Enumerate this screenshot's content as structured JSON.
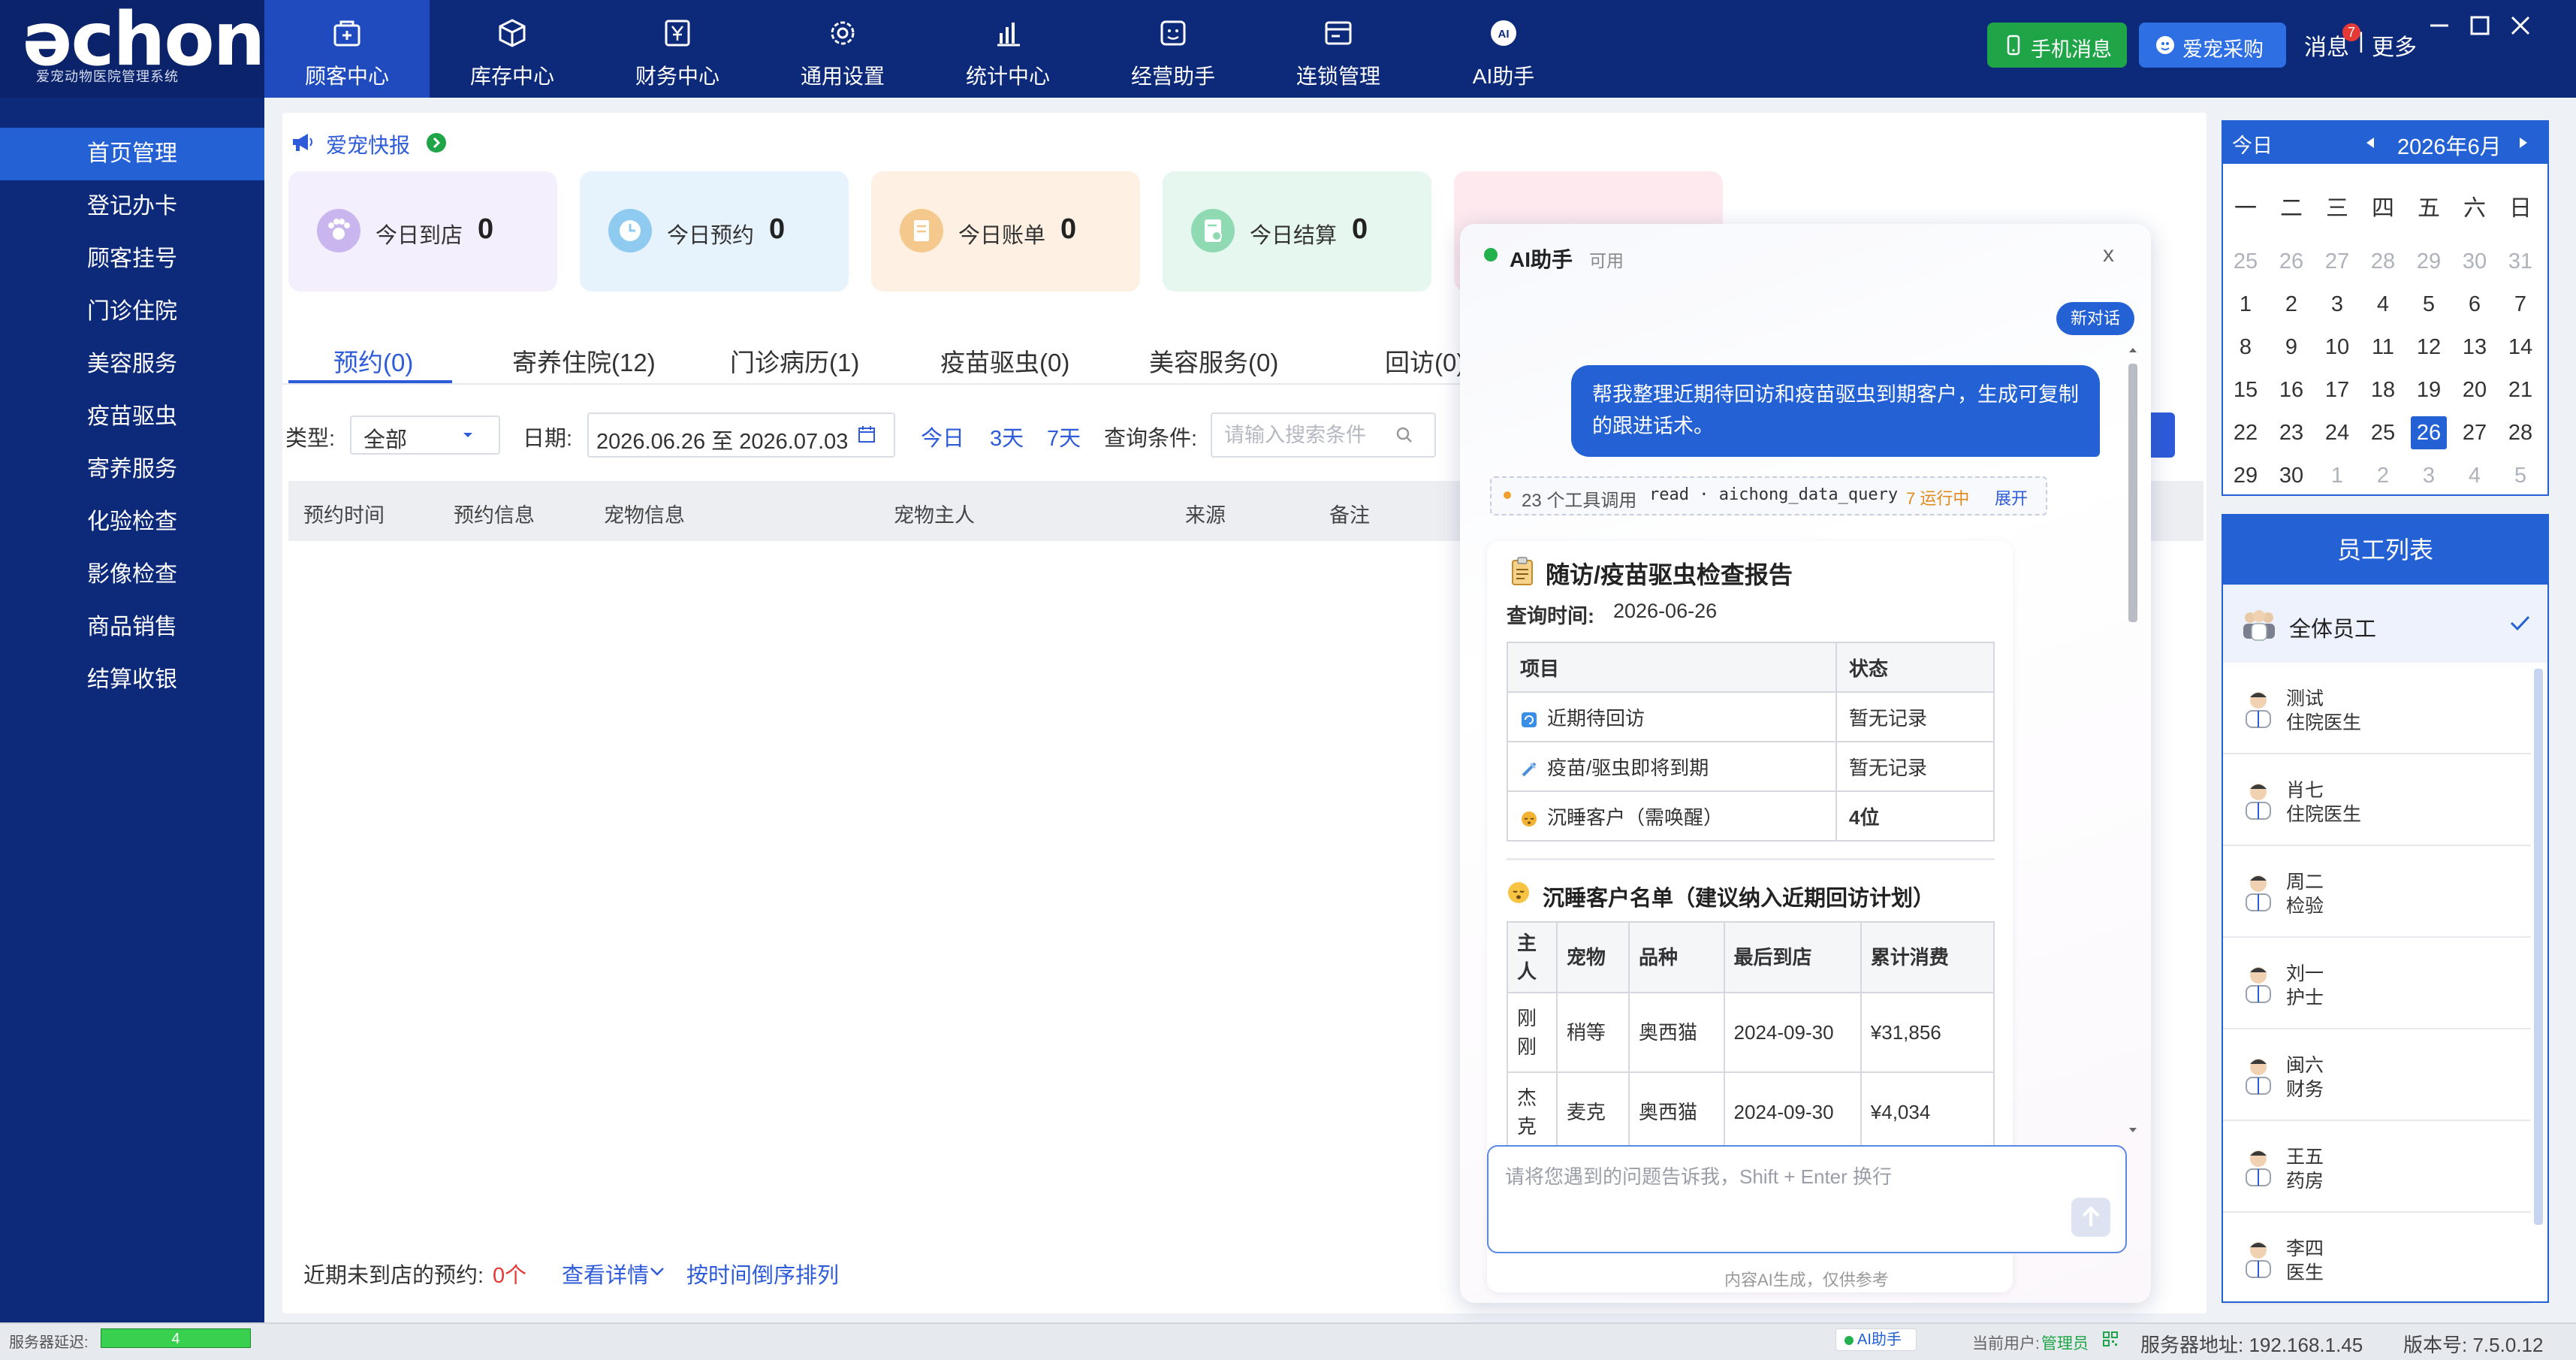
{
  "app": {
    "logo": "əchong",
    "logo_subtitle": "爱宠动物医院管理系统"
  },
  "topnav": [
    {
      "label": "顾客中心",
      "icon": "customer-center-icon",
      "active": true
    },
    {
      "label": "库存中心",
      "icon": "inventory-box-icon"
    },
    {
      "label": "财务中心",
      "icon": "finance-yen-icon"
    },
    {
      "label": "通用设置",
      "icon": "settings-gear-icon"
    },
    {
      "label": "统计中心",
      "icon": "statistics-chart-icon"
    },
    {
      "label": "经营助手",
      "icon": "business-assistant-icon"
    },
    {
      "label": "连锁管理",
      "icon": "chain-management-icon"
    },
    {
      "label": "AI助手",
      "icon": "ai-assistant-icon"
    }
  ],
  "window": {
    "mobile_msg": "手机消息",
    "purchase": "爱宠采购",
    "messages": "消息",
    "badge": "7",
    "separator": "|",
    "more": "更多"
  },
  "sidebar": [
    {
      "label": "首页管理",
      "active": true
    },
    {
      "label": "登记办卡"
    },
    {
      "label": "顾客挂号"
    },
    {
      "label": "门诊住院"
    },
    {
      "label": "美容服务"
    },
    {
      "label": "疫苗驱虫"
    },
    {
      "label": "寄养服务"
    },
    {
      "label": "化验检查"
    },
    {
      "label": "影像检查"
    },
    {
      "label": "商品销售"
    },
    {
      "label": "结算收银"
    }
  ],
  "bulletin": "爱宠快报",
  "cards": [
    {
      "label": "今日到店",
      "value": "0",
      "bg": "#f3effd",
      "icon_bg": "#c9b6ee",
      "icon": "paw-icon"
    },
    {
      "label": "今日预约",
      "value": "0",
      "bg": "#e6f3fd",
      "icon_bg": "#8fcaf1",
      "icon": "clock-icon"
    },
    {
      "label": "今日账单",
      "value": "0",
      "bg": "#fef1e3",
      "icon_bg": "#f5c88d",
      "icon": "bill-icon"
    },
    {
      "label": "今日结算",
      "value": "0",
      "bg": "#e6f7ef",
      "icon_bg": "#8fd9b3",
      "icon": "settlement-icon"
    }
  ],
  "tabs": [
    "预约(0)",
    "寄养住院(12)",
    "门诊病历(1)",
    "疫苗驱虫(0)",
    "美容服务(0)",
    "回访(0)"
  ],
  "filters": {
    "type_label": "类型:",
    "type_value": "全部",
    "date_label": "日期:",
    "date_range": "2026.06.26 至 2026.07.03",
    "quick": [
      "今日",
      "3天",
      "7天"
    ],
    "query_label": "查询条件:",
    "search_placeholder": "请输入搜索条件"
  },
  "table_headers": [
    "预约时间",
    "预约信息",
    "宠物信息",
    "宠物主人",
    "来源",
    "备注"
  ],
  "bottom": {
    "label": "近期未到店的预约:",
    "count": "0个",
    "detail": "查看详情",
    "sort": "按时间倒序排列"
  },
  "ai": {
    "title": "AI助手",
    "status": "可用",
    "close": "x",
    "new_chat": "新对话",
    "user_message": "帮我整理近期待回访和疫苗驱虫到期客户，生成可复制的跟进话术。",
    "tool_text": "23 个工具调用",
    "tool_code": "read · aichong_data_query",
    "tool_running": "7 运行中",
    "tool_expand": "展开",
    "report_title": "随访/疫苗驱虫检查报告",
    "report_time_label": "查询时间:",
    "report_time": "2026-06-26",
    "table1": {
      "headers": [
        "项目",
        "状态"
      ],
      "rows": [
        {
          "item": "近期待回访",
          "status": "暂无记录",
          "icon": "revisit-icon",
          "color": "#3a8ee6"
        },
        {
          "item": "疫苗/驱虫即将到期",
          "status": "暂无记录",
          "icon": "syringe-icon",
          "color": "#4a90d9"
        },
        {
          "item": "沉睡客户（需唤醒）",
          "status": "4位",
          "icon": "sleeping-face-icon",
          "color": "#f2b233"
        }
      ]
    },
    "sub_title": "沉睡客户名单（建议纳入近期回访计划）",
    "table2": {
      "headers": [
        "主人",
        "宠物",
        "品种",
        "最后到店",
        "累计消费"
      ],
      "rows": [
        [
          "刚刚",
          "稍等",
          "奥西猫",
          "2024-09-30",
          "¥31,856"
        ],
        [
          "杰克",
          "麦克",
          "奥西猫",
          "2024-09-30",
          "¥4,034"
        ]
      ]
    },
    "input_placeholder": "请将您遇到的问题告诉我，Shift + Enter 换行",
    "footer": "内容AI生成，仅供参考"
  },
  "calendar": {
    "today": "今日",
    "month": "2026年6月",
    "weekdays": [
      "一",
      "二",
      "三",
      "四",
      "五",
      "六",
      "日"
    ],
    "weeks": [
      [
        "25",
        "26",
        "27",
        "28",
        "29",
        "30",
        "31"
      ],
      [
        "1",
        "2",
        "3",
        "4",
        "5",
        "6",
        "7"
      ],
      [
        "8",
        "9",
        "10",
        "11",
        "12",
        "13",
        "14"
      ],
      [
        "15",
        "16",
        "17",
        "18",
        "19",
        "20",
        "21"
      ],
      [
        "22",
        "23",
        "24",
        "25",
        "26",
        "27",
        "28"
      ],
      [
        "29",
        "30",
        "1",
        "2",
        "3",
        "4",
        "5"
      ]
    ],
    "selected": "26"
  },
  "staff": {
    "title": "员工列表",
    "all": "全体员工",
    "members": [
      {
        "name": "测试",
        "role": "住院医生"
      },
      {
        "name": "肖七",
        "role": "住院医生"
      },
      {
        "name": "周二",
        "role": "检验"
      },
      {
        "name": "刘一",
        "role": "护士"
      },
      {
        "name": "闽六",
        "role": "财务"
      },
      {
        "name": "王五",
        "role": "药房"
      },
      {
        "name": "李四",
        "role": "医生"
      }
    ]
  },
  "statusbar": {
    "delay_label": "服务器延迟:",
    "delay_value": "4",
    "ai": "AI助手",
    "user_label": "当前用户:",
    "user": "管理员",
    "server": "服务器地址: 192.168.1.45",
    "version": "版本号: 7.5.0.12"
  },
  "colors": {
    "nav": "#0d2a7a",
    "accent": "#2361d4",
    "link": "#2d5bd9",
    "green": "#1fa548",
    "alert": "#e53935"
  }
}
